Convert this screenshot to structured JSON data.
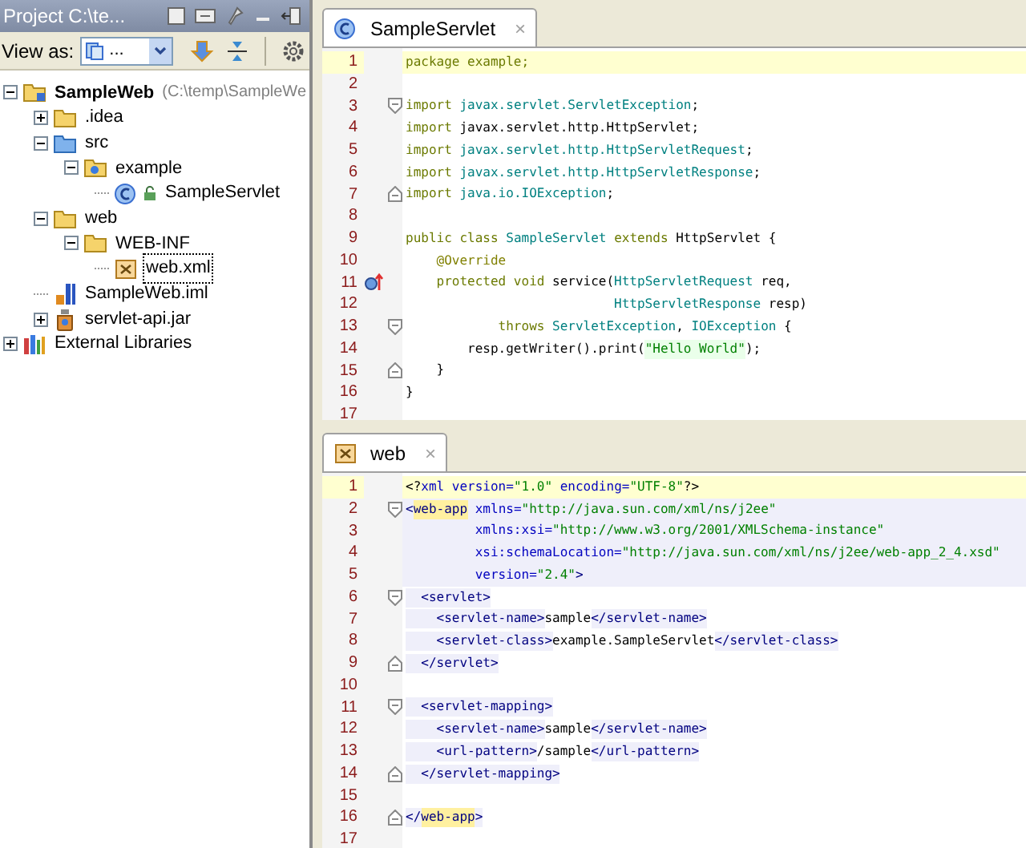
{
  "project_panel": {
    "title": "Project C:\\te...",
    "view_as_label": "View as:",
    "view_as_value": "...",
    "tree": [
      {
        "label": "SampleWeb",
        "hint": "(C:\\temp\\SampleWe",
        "kind": "project",
        "expanded": true,
        "selected": false,
        "children": [
          {
            "label": ".idea",
            "kind": "folder",
            "expanded": false,
            "selected": false
          },
          {
            "label": "src",
            "kind": "source",
            "expanded": true,
            "selected": false,
            "children": [
              {
                "label": "example",
                "kind": "package",
                "expanded": true,
                "selected": false,
                "children": [
                  {
                    "label": "SampleServlet",
                    "kind": "class",
                    "selected": false
                  }
                ]
              }
            ]
          },
          {
            "label": "web",
            "kind": "folder",
            "expanded": true,
            "selected": false,
            "children": [
              {
                "label": "WEB-INF",
                "kind": "folder",
                "expanded": true,
                "selected": false,
                "children": [
                  {
                    "label": "web.xml",
                    "kind": "xml",
                    "selected": true
                  }
                ]
              }
            ]
          },
          {
            "label": "SampleWeb.iml",
            "kind": "module",
            "selected": false
          },
          {
            "label": "servlet-api.jar",
            "kind": "jar",
            "expanded": false,
            "selected": false
          }
        ]
      },
      {
        "label": "External Libraries",
        "kind": "libraries",
        "expanded": false,
        "selected": false
      }
    ]
  },
  "editors": [
    {
      "tab": {
        "label": "SampleServlet",
        "kind": "class",
        "close": "×",
        "selected": true
      },
      "lines": [
        {
          "n": "1",
          "current": true,
          "highlight": false,
          "tokens": [
            {
              "kw": "package example;"
            }
          ]
        },
        {
          "n": "2",
          "current": false,
          "highlight": false
        },
        {
          "n": "3",
          "current": false,
          "highlight": false,
          "fold": {
            "kind": "start"
          },
          "tokens": [
            {
              "kw": "import"
            },
            {
              "ref": " javax.servlet.ServletException"
            },
            {
              "pl": ";"
            }
          ]
        },
        {
          "n": "4",
          "current": false,
          "highlight": false,
          "tokens": [
            {
              "kw": "import"
            },
            {
              "pl": " javax.servlet.http.HttpServlet;"
            }
          ]
        },
        {
          "n": "5",
          "current": false,
          "highlight": false,
          "tokens": [
            {
              "kw": "import"
            },
            {
              "ref": " javax.servlet.http.HttpServletRequest"
            },
            {
              "pl": ";"
            }
          ]
        },
        {
          "n": "6",
          "current": false,
          "highlight": false,
          "tokens": [
            {
              "kw": "import"
            },
            {
              "ref": " javax.servlet.http.HttpServletResponse"
            },
            {
              "pl": ";"
            }
          ]
        },
        {
          "n": "7",
          "current": false,
          "highlight": false,
          "fold": {
            "kind": "end"
          },
          "tokens": [
            {
              "kw": "import"
            },
            {
              "ref": " java.io.IOException"
            },
            {
              "pl": ";"
            }
          ]
        },
        {
          "n": "8",
          "current": false,
          "highlight": false
        },
        {
          "n": "9",
          "current": false,
          "highlight": false,
          "tokens": [
            {
              "kw": "public class "
            },
            {
              "ref": "SampleServlet"
            },
            {
              "kw": " extends "
            },
            {
              "pl": "HttpServlet {"
            }
          ]
        },
        {
          "n": "10",
          "current": false,
          "highlight": false,
          "tokens": [
            {
              "ann": "    @Override"
            }
          ]
        },
        {
          "n": "11",
          "current": false,
          "highlight": false,
          "marker": {
            "kind": "override"
          },
          "tokens": [
            {
              "kw": "    protected void "
            },
            {
              "pl": "service("
            },
            {
              "ref": "HttpServletRequest"
            },
            {
              "pl": " req,"
            }
          ]
        },
        {
          "n": "12",
          "current": false,
          "highlight": false,
          "tokens": [
            {
              "ref": "                           HttpServletResponse"
            },
            {
              "pl": " resp)"
            }
          ]
        },
        {
          "n": "13",
          "current": false,
          "highlight": false,
          "fold": {
            "kind": "start"
          },
          "tokens": [
            {
              "kw": "            throws "
            },
            {
              "ref": "ServletException"
            },
            {
              "pl": ", "
            },
            {
              "ref": "IOException"
            },
            {
              "pl": " {"
            }
          ]
        },
        {
          "n": "14",
          "current": false,
          "highlight": false,
          "tokens": [
            {
              "pl": "        resp.getWriter().print("
            },
            {
              "str": "\"Hello World\""
            },
            {
              "pl": ");"
            }
          ]
        },
        {
          "n": "15",
          "current": false,
          "highlight": false,
          "fold": {
            "kind": "end"
          },
          "tokens": [
            {
              "pl": "    }"
            }
          ]
        },
        {
          "n": "16",
          "current": false,
          "highlight": false,
          "tokens": [
            {
              "pl": "}"
            }
          ]
        },
        {
          "n": "17",
          "current": false,
          "highlight": false
        }
      ]
    },
    {
      "tab": {
        "label": "web",
        "kind": "xml",
        "close": "×",
        "selected": true
      },
      "lines": [
        {
          "n": "1",
          "current": true,
          "highlight": false,
          "tokens": [
            {
              "pl": "<?"
            },
            {
              "attr": "xml version="
            },
            {
              "val": "\"1.0\""
            },
            {
              "attr": " encoding="
            },
            {
              "val": "\"UTF-8\""
            },
            {
              "pl": "?>"
            }
          ]
        },
        {
          "n": "2",
          "current": false,
          "highlight": true,
          "fold": {
            "kind": "start"
          },
          "tokens": [
            {
              "tag": "<"
            },
            {
              "match": "web-app"
            },
            {
              "attr": " xmlns="
            },
            {
              "val": "\"http://java.sun.com/xml/ns/j2ee\""
            }
          ]
        },
        {
          "n": "3",
          "current": false,
          "highlight": true,
          "tokens": [
            {
              "attr": "         xmlns:xsi="
            },
            {
              "val": "\"http://www.w3.org/2001/XMLSchema-instance\""
            }
          ]
        },
        {
          "n": "4",
          "current": false,
          "highlight": true,
          "tokens": [
            {
              "attr": "         xsi:schemaLocation="
            },
            {
              "val": "\"http://java.sun.com/xml/ns/j2ee/web-app_2_4.xsd\""
            }
          ]
        },
        {
          "n": "5",
          "current": false,
          "highlight": true,
          "tokens": [
            {
              "attr": "         version="
            },
            {
              "val": "\"2.4\""
            },
            {
              "tag": ">"
            }
          ]
        },
        {
          "n": "6",
          "current": false,
          "highlight": false,
          "fold": {
            "kind": "start"
          },
          "tokens": [
            {
              "tag": "  <servlet>"
            }
          ]
        },
        {
          "n": "7",
          "current": false,
          "highlight": false,
          "tokens": [
            {
              "tag": "    <servlet-name>"
            },
            {
              "pl": "sample"
            },
            {
              "tag": "</servlet-name>"
            }
          ]
        },
        {
          "n": "8",
          "current": false,
          "highlight": false,
          "tokens": [
            {
              "tag": "    <servlet-class>"
            },
            {
              "pl": "example.SampleServlet"
            },
            {
              "tag": "</servlet-class>"
            }
          ]
        },
        {
          "n": "9",
          "current": false,
          "highlight": false,
          "fold": {
            "kind": "end"
          },
          "tokens": [
            {
              "tag": "  </servlet>"
            }
          ]
        },
        {
          "n": "10",
          "current": false,
          "highlight": false
        },
        {
          "n": "11",
          "current": false,
          "highlight": false,
          "fold": {
            "kind": "start"
          },
          "tokens": [
            {
              "tag": "  <servlet-mapping>"
            }
          ]
        },
        {
          "n": "12",
          "current": false,
          "highlight": false,
          "tokens": [
            {
              "tag": "    <servlet-name>"
            },
            {
              "pl": "sample"
            },
            {
              "tag": "</servlet-name>"
            }
          ]
        },
        {
          "n": "13",
          "current": false,
          "highlight": false,
          "tokens": [
            {
              "tag": "    <url-pattern>"
            },
            {
              "pl": "/sample"
            },
            {
              "tag": "</url-pattern>"
            }
          ]
        },
        {
          "n": "14",
          "current": false,
          "highlight": false,
          "fold": {
            "kind": "end"
          },
          "tokens": [
            {
              "tag": "  </servlet-mapping>"
            }
          ]
        },
        {
          "n": "15",
          "current": false,
          "highlight": false
        },
        {
          "n": "16",
          "current": false,
          "highlight": false,
          "fold": {
            "kind": "end"
          },
          "tokens": [
            {
              "tag": "</"
            },
            {
              "match": "web-app"
            },
            {
              "tag": ">"
            }
          ]
        },
        {
          "n": "17",
          "current": false,
          "highlight": false
        }
      ]
    }
  ]
}
